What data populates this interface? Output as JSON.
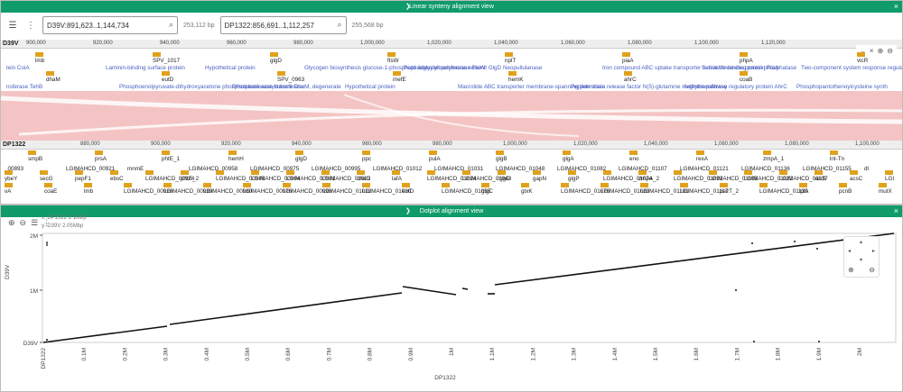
{
  "synteny": {
    "title": "Linear synteny alignment view",
    "top_loc": "D39V:891,623..1,144,734",
    "top_bp": "253,112 bp",
    "bottom_loc": "DP1322:856,691..1,112,257",
    "bottom_bp": "255,568 bp",
    "top_genome": "D39V",
    "bottom_genome": "DP1322",
    "top_ticks": [
      "900,000",
      "920,000",
      "940,000",
      "960,000",
      "980,000",
      "1,000,000",
      "1,020,000",
      "1,040,000",
      "1,060,000",
      "1,080,000",
      "1,100,000",
      "1,120,000"
    ],
    "bottom_ticks": [
      "880,000",
      "900,000",
      "920,000",
      "940,000",
      "960,000",
      "980,000",
      "1,000,000",
      "1,020,000",
      "1,040,000",
      "1,060,000",
      "1,080,000",
      "1,100,000"
    ],
    "top_names": [
      "lmb",
      "SPV_1017",
      "glgD",
      "ftsW",
      "nplT",
      "piaA",
      "phpA",
      "vicR",
      "dhaM",
      "eutD",
      "SPV_0963",
      "mefE",
      "hemK",
      "ahrC",
      "coaB"
    ],
    "top_products_1": [
      "tein CoiA",
      "Laminin-binding surface protein",
      "Hypothetical protein",
      "Glycogen biosynthesis glucose-1-phosphate adenylyltransferase subunit GlgD",
      "Peptidoglycan polymerase FtsW",
      "Neopullulanase",
      "Iron compound ABC uptake transporter substrate-binding protein PiaA",
      "Serine/threonine protein phosphatase",
      "Two-component system response regulat"
    ],
    "top_products_2": [
      "nsferase TehB",
      "Phosphoenolpyruvate-dihydroxyacetone phosphotransferase subunit DhaM, degenerate",
      "Phosphate acetyltransferase",
      "Hypothetical protein",
      "Macrolide ABC transporter membrane-spanning permease",
      "Peptide chain release factor N(5)-glutamine methyltransferase",
      "Arginine pathway regulatory protein AhrC",
      "Phosphopantothenoylcysteine synth"
    ],
    "bottom_row1": [
      "smpB",
      "prsA",
      "phtE_1",
      "hemH",
      "glgD",
      "ppc",
      "pulA",
      "glgB",
      "glgA",
      "eno",
      "rexA",
      "zmpA_1",
      "lnt-Tn"
    ],
    "bottom_row2": [
      "_00893",
      "LGIMAHCD_00921",
      "mnmE",
      "LGIMAHCD_00958",
      "LGIMAHCD_00975",
      "LGIMAHCD_00995",
      "LGIMAHCD_01012",
      "LGIMAHCD_01031",
      "LGIMAHCD_01048",
      "LGIMAHCD_01082",
      "LGIMAHCD_01107",
      "LGIMAHCD_01121",
      "LGIMAHCD_01136",
      "LGIMAHCD_01155",
      "dl"
    ],
    "bottom_row3": [
      "ybeY",
      "secG",
      "pepF1",
      "ebsC",
      "LGIMAHCD_00924",
      "phtE_2",
      "LGIMAHCD_00945",
      "LGIMAHCD_00964",
      "LGIMAHCD_00981",
      "LGIMAHCD_01002",
      "dhaG",
      "lafA",
      "LGIMAHCD_01024",
      "LGIMAHCD_01043",
      "rggD",
      "gapN",
      "glgP",
      "LGIMAHCD_01074",
      "zmpA_2",
      "LGIMAHCD_01092",
      "LGIMAHCD_01108",
      "LGIMAHCD_01122",
      "LGIMAHCD_01137",
      "xerS",
      "acsC",
      "LGI"
    ],
    "bottom_row4": [
      "vA",
      "coaE",
      "lmb",
      "LGIMAHCD_00916",
      "LGIMAHCD_00939",
      "LGIMAHCD_00960",
      "LGIMAHCD_00976",
      "LGIMAHCD_00996",
      "LGIMAHCD_01011",
      "LGIMAHCD_01030",
      "eutD",
      "LGIMAHCD_01055",
      "glgC",
      "gtxK",
      "LGIMAHCD_01076",
      "LGIMAHCD_01083",
      "LGIMAHCD_01101",
      "LGIMAHCD_01117",
      "pezT_2",
      "LGIMAHCD_01139",
      "lplA",
      "pcnB",
      "mutX"
    ]
  },
  "dotplot": {
    "title": "Dotplot alignment view",
    "info_x": "x: DP1322 2.1Mbp",
    "info_y": "y: D39V 2.05Mbp",
    "y_genome": "D39V",
    "x_genome": "DP1322",
    "y_ticks": [
      "2M",
      "1M",
      "D39V"
    ],
    "x_ticks": [
      "DP1322",
      "0.1M",
      "0.2M",
      "0.3M",
      "0.4M",
      "0.5M",
      "0.6M",
      "0.7M",
      "0.8M",
      "0.9M",
      "1M",
      "1.1M",
      "1.2M",
      "1.3M",
      "1.4M",
      "1.5M",
      "1.6M",
      "1.7M",
      "1.8M",
      "1.9M",
      "2M"
    ],
    "x_axis_title": "DP1322"
  },
  "colors": {
    "titlebar": "#0f9b6a",
    "gene": "#e0a11b",
    "synteny": "#f4c4c4"
  }
}
